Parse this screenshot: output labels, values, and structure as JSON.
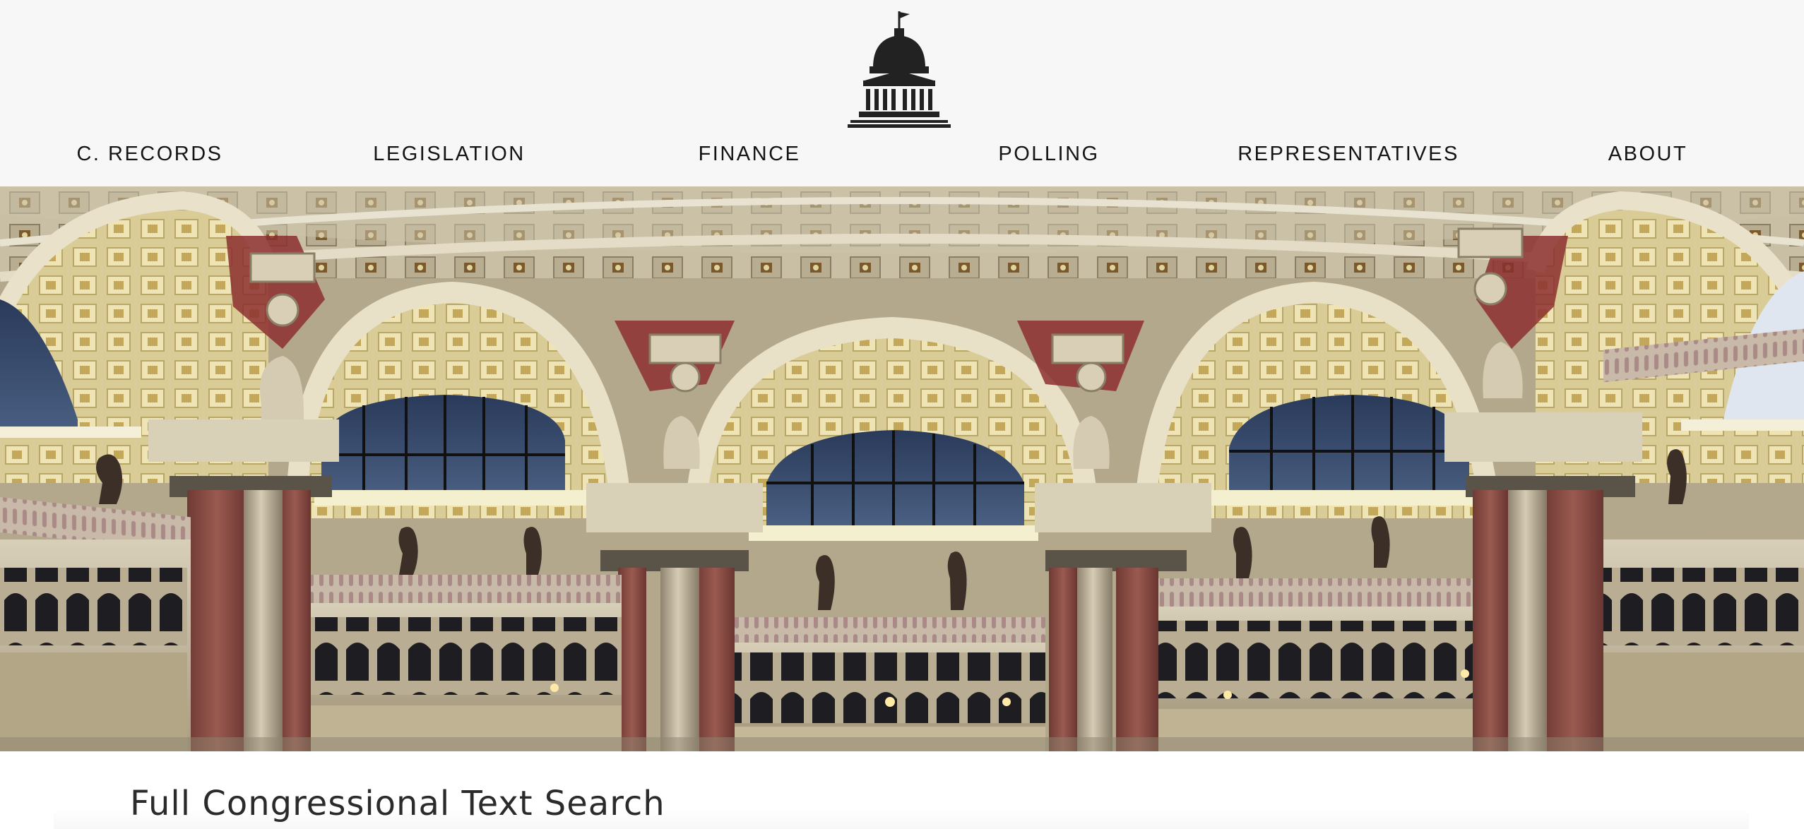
{
  "header": {
    "logo": {
      "icon": "capitol-dome-icon",
      "color": "#222222"
    },
    "nav": [
      {
        "label": "C. RECORDS"
      },
      {
        "label": "LEGISLATION"
      },
      {
        "label": "FINANCE"
      },
      {
        "label": "POLLING"
      },
      {
        "label": "REPRESENTATIVES"
      },
      {
        "label": "ABOUT"
      }
    ]
  },
  "hero": {
    "image": "library-of-congress-reading-room-interior"
  },
  "main": {
    "title": "Full Congressional Text Search"
  },
  "colors": {
    "header_bg": "#f7f7f7",
    "nav_text": "#141414",
    "title_text": "#2b2b2b"
  }
}
